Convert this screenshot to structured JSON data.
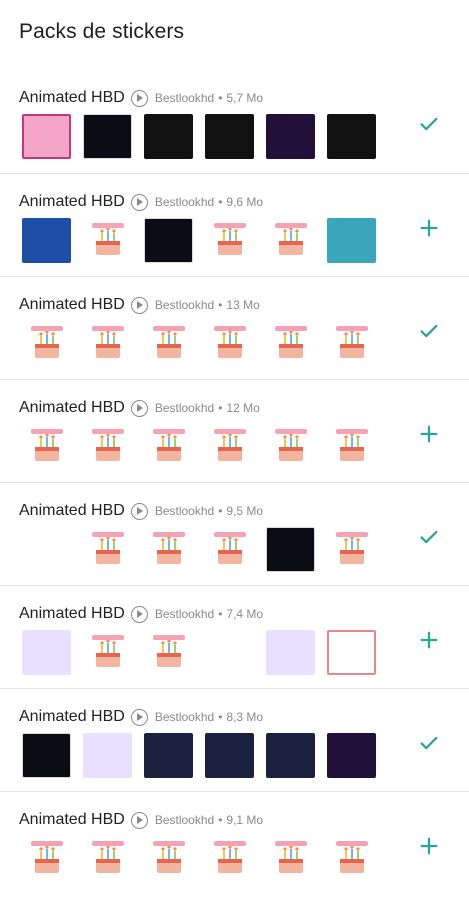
{
  "header": {
    "title": "Packs de stickers"
  },
  "icons": {
    "play": "play-circle-icon",
    "added": "check-icon",
    "add": "plus-icon"
  },
  "colors": {
    "accent": "#26a69a",
    "meta": "#8a8a8a",
    "divider": "#e4e4e4"
  },
  "packs": [
    {
      "name": "Animated HBD",
      "author": "Bestlookhd",
      "sep": "•",
      "size": "5,7 Mo",
      "status": "added"
    },
    {
      "name": "Animated HBD",
      "author": "Bestlookhd",
      "sep": "•",
      "size": "9,6 Mo",
      "status": "add"
    },
    {
      "name": "Animated HBD",
      "author": "Bestlookhd",
      "sep": "•",
      "size": "13 Mo",
      "status": "added"
    },
    {
      "name": "Animated HBD",
      "author": "Bestlookhd",
      "sep": "•",
      "size": "12 Mo",
      "status": "add"
    },
    {
      "name": "Animated HBD",
      "author": "Bestlookhd",
      "sep": "•",
      "size": "9,5 Mo",
      "status": "added"
    },
    {
      "name": "Animated HBD",
      "author": "Bestlookhd",
      "sep": "•",
      "size": "7,4 Mo",
      "status": "add"
    },
    {
      "name": "Animated HBD",
      "author": "Bestlookhd",
      "sep": "•",
      "size": "8,3 Mo",
      "status": "added"
    },
    {
      "name": "Animated HBD",
      "author": "Bestlookhd",
      "sep": "•",
      "size": "9,1 Mo",
      "status": "add"
    }
  ]
}
